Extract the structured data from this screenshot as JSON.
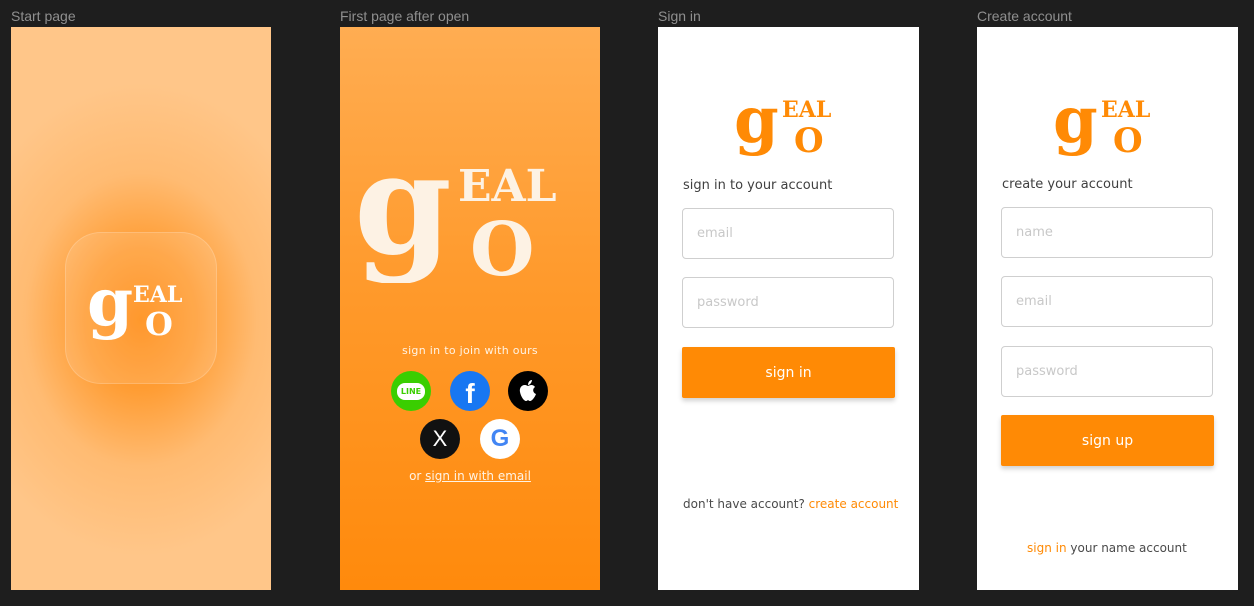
{
  "labels": {
    "start": "Start page",
    "first": "First page after open",
    "signin": "Sign in",
    "create": "Create account"
  },
  "colors": {
    "brand_orange": "#ff8a05",
    "start_bg": "#ffc689",
    "white": "#ffffff",
    "frame_bg": "#1e1e1e"
  },
  "logo": {
    "big_letter": "g",
    "small_top": "EAL",
    "small_bottom": "O"
  },
  "first_page": {
    "join_text": "sign in to join with ours",
    "or_text": "or",
    "email_link": "sign in with email",
    "socials": [
      {
        "name": "line",
        "label": "LINE",
        "icon": "line-icon",
        "color": "#3ace01"
      },
      {
        "name": "facebook",
        "label": "f",
        "icon": "facebook-icon",
        "color": "#1877f2"
      },
      {
        "name": "apple",
        "label": "",
        "icon": "apple-icon",
        "color": "#000000"
      },
      {
        "name": "x",
        "label": "X",
        "icon": "x-icon",
        "color": "#111111"
      },
      {
        "name": "google",
        "label": "G",
        "icon": "google-icon",
        "color": "#ffffff"
      }
    ]
  },
  "signin_page": {
    "title": "sign in to your account",
    "email_placeholder": "email",
    "password_placeholder": "password",
    "button": "sign in",
    "footer_text": "don't have account?",
    "footer_link": "create account"
  },
  "create_page": {
    "title": "create your account",
    "name_placeholder": "name",
    "email_placeholder": "email",
    "password_placeholder": "password",
    "button": "sign up",
    "footer_link": "sign in",
    "footer_text": "your name account"
  }
}
